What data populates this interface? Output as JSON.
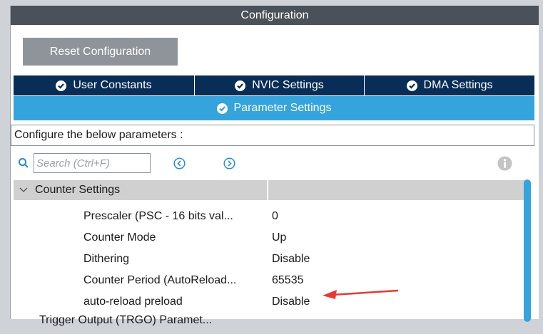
{
  "window": {
    "title": "Configuration"
  },
  "reset_button": {
    "label": "Reset Configuration"
  },
  "tabs": [
    {
      "label": "User Constants"
    },
    {
      "label": "NVIC Settings"
    },
    {
      "label": "DMA Settings"
    }
  ],
  "active_tab": {
    "label": "Parameter Settings"
  },
  "configure_text": "Configure the below parameters :",
  "search": {
    "placeholder": "Search (Ctrl+F)",
    "value": ""
  },
  "group": {
    "label": "Counter Settings"
  },
  "parameters": [
    {
      "name": "Prescaler (PSC - 16 bits val...",
      "value": "0"
    },
    {
      "name": "Counter Mode",
      "value": "Up"
    },
    {
      "name": "Dithering",
      "value": "Disable"
    },
    {
      "name": "Counter Period (AutoReload...",
      "value": "65535"
    },
    {
      "name": "auto-reload preload",
      "value": "Disable"
    }
  ],
  "next_group_partial": {
    "label": "Trigger Output (TRGO) Paramet..."
  },
  "colors": {
    "title_bar": "#4a5159",
    "tab_dark": "#082d56",
    "tab_active": "#35a3dc",
    "annotation_arrow": "#e53935"
  }
}
